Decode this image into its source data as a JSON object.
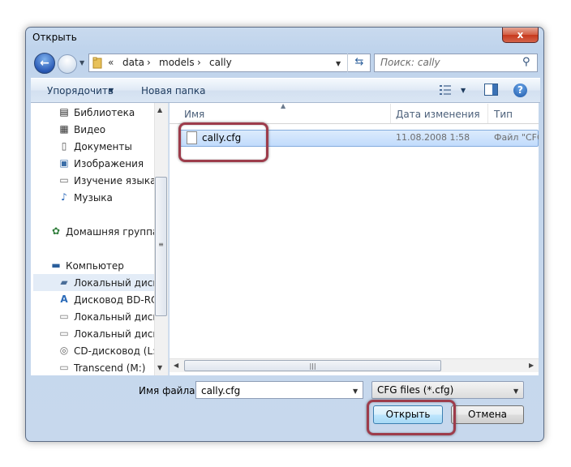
{
  "window": {
    "title": "Открыть",
    "close_label": "x"
  },
  "navigation": {
    "back_label": "←",
    "breadcrumb": {
      "prefix": "«",
      "items": [
        "data",
        "models",
        "cally"
      ],
      "separator": "›"
    },
    "search_placeholder": "Поиск: cally"
  },
  "toolbar": {
    "organize_label": "Упорядочить",
    "new_folder_label": "Новая папка",
    "help_label": "?"
  },
  "sidebar": {
    "items": [
      {
        "label": "Библиотека",
        "icon": "library-icon"
      },
      {
        "label": "Видео",
        "icon": "video-icon"
      },
      {
        "label": "Документы",
        "icon": "documents-icon"
      },
      {
        "label": "Изображения",
        "icon": "pictures-icon"
      },
      {
        "label": "Изучение языка",
        "icon": "library-folder-icon"
      },
      {
        "label": "Музыка",
        "icon": "music-icon"
      },
      {
        "label": "Домашняя группа",
        "icon": "homegroup-icon"
      },
      {
        "label": "Компьютер",
        "icon": "computer-icon"
      },
      {
        "label": "Локальный диск (",
        "icon": "system-drive-icon",
        "selected": true
      },
      {
        "label": "Дисковод BD-ROM",
        "icon": "bd-rom-icon"
      },
      {
        "label": "Локальный диск (",
        "icon": "drive-icon"
      },
      {
        "label": "Локальный диск (",
        "icon": "drive-icon"
      },
      {
        "label": "CD-дисковод (L:)",
        "icon": "cd-drive-icon"
      },
      {
        "label": "Transcend (M:)",
        "icon": "usb-drive-icon"
      }
    ]
  },
  "file_list": {
    "columns": [
      "Имя",
      "Дата изменения",
      "Тип"
    ],
    "rows": [
      {
        "name": "cally.cfg",
        "date": "11.08.2008 1:58",
        "type": "Файл \"CFG\""
      }
    ]
  },
  "bottom": {
    "filename_label": "Имя файла:",
    "filename_value": "cally.cfg",
    "filetype_value": "CFG files (*.cfg)",
    "open_label": "Открыть",
    "cancel_label": "Отмена"
  },
  "colors": {
    "highlight": "#9d3c4b",
    "selection": "#c1dbfc"
  }
}
